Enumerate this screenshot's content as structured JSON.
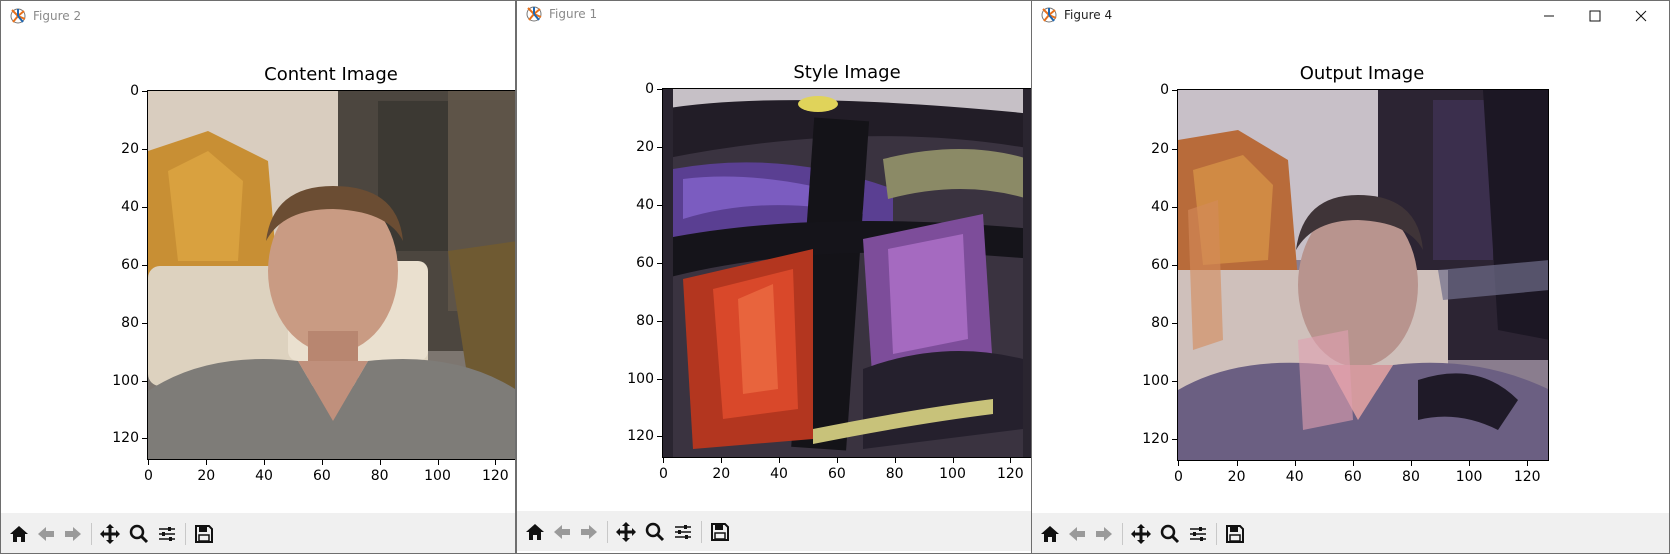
{
  "windows": [
    {
      "id": "figure-2",
      "title": "Figure 2",
      "axes_title": "Content Image"
    },
    {
      "id": "figure-1",
      "title": "Figure 1",
      "axes_title": "Style Image"
    },
    {
      "id": "figure-4",
      "title": "Figure 4",
      "axes_title": "Output Image"
    }
  ],
  "axes": {
    "y_ticks": [
      "0",
      "20",
      "40",
      "60",
      "80",
      "100",
      "120"
    ],
    "x_ticks": [
      "0",
      "20",
      "40",
      "60",
      "80",
      "100",
      "120"
    ]
  },
  "toolbar": {
    "icons": [
      "home-icon",
      "back-arrow-icon",
      "forward-arrow-icon",
      "pan-icon",
      "zoom-icon",
      "configure-subplots-icon",
      "save-icon"
    ]
  },
  "window_controls": [
    "minimize-icon",
    "maximize-icon",
    "close-icon"
  ]
}
